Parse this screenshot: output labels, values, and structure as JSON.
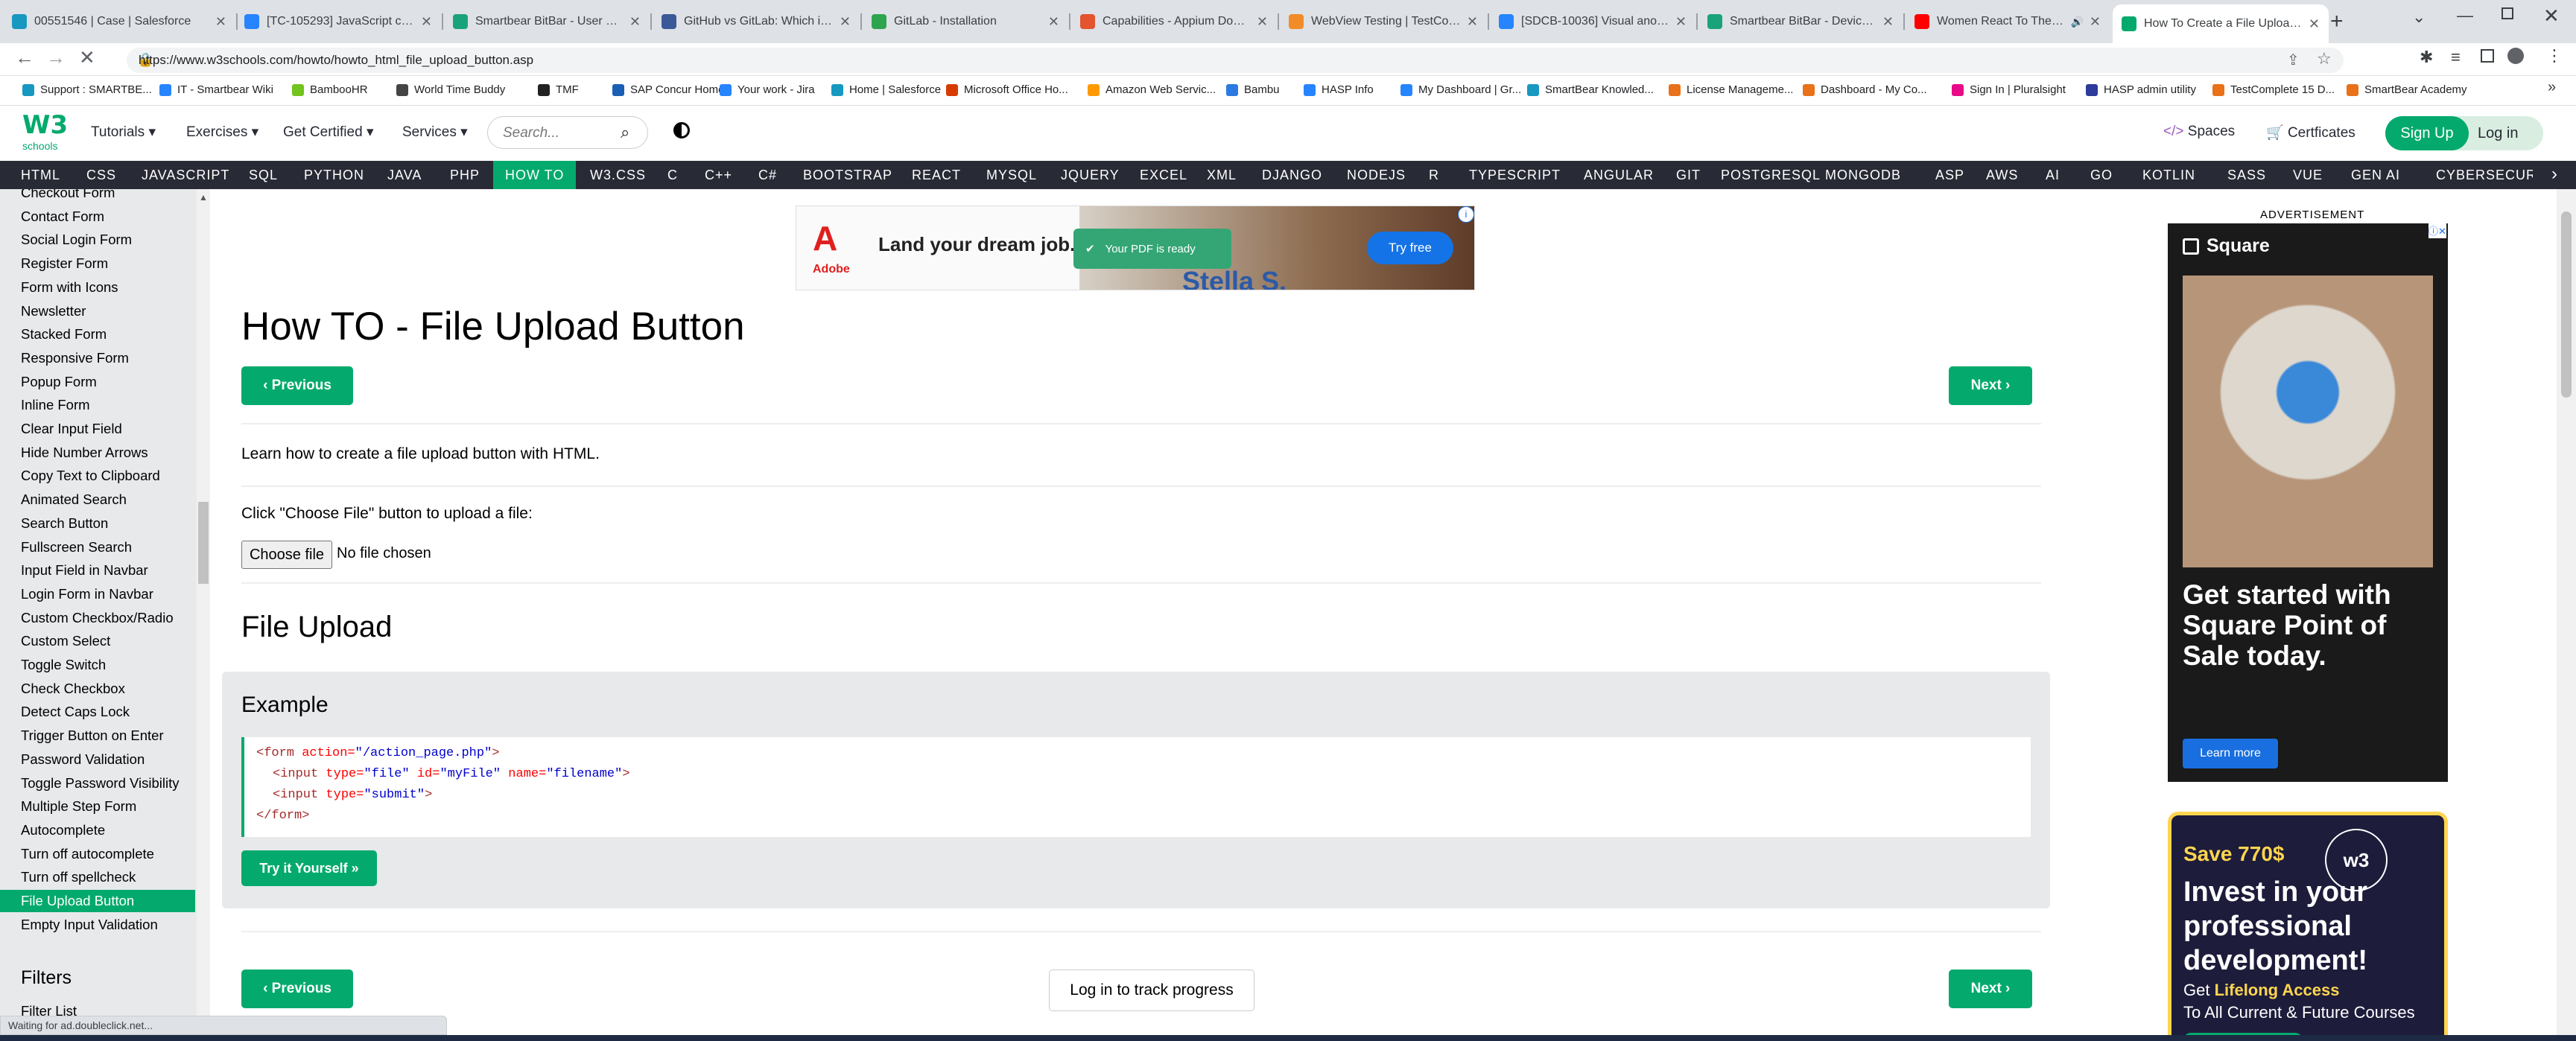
{
  "browser": {
    "tabs": [
      {
        "title": "00551546 | Case | Salesforce",
        "color": "#1798c1"
      },
      {
        "title": "[TC-105293] JavaScript code ...",
        "color": "#2684ff"
      },
      {
        "title": "Smartbear BitBar - User Detail...",
        "color": "#1aa37a"
      },
      {
        "title": "GitHub vs GitLab: Which is Be...",
        "color": "#3b5998"
      },
      {
        "title": "GitLab - Installation",
        "color": "#2ea44f"
      },
      {
        "title": "Capabilities - Appium Docum...",
        "color": "#e3542f"
      },
      {
        "title": "WebView Testing | TestComp...",
        "color": "#f28c28"
      },
      {
        "title": "[SDCB-10036] Visual anomali...",
        "color": "#2684ff"
      },
      {
        "title": "Smartbear BitBar - Device Se...",
        "color": "#1aa37a"
      },
      {
        "title": "Women React To The Re...",
        "color": "#ff0000"
      },
      {
        "title": "How To Create a File Upload ...",
        "color": "#04AA6D"
      }
    ],
    "new_tab": "+",
    "url": "https://www.w3schools.com/howto/howto_html_file_upload_button.asp",
    "bookmarks": [
      {
        "label": "Support : SMARTBE...",
        "color": "#1798c1"
      },
      {
        "label": "IT - Smartbear Wiki",
        "color": "#2684ff"
      },
      {
        "label": "BambooHR",
        "color": "#73c41d"
      },
      {
        "label": "World Time Buddy",
        "color": "#444"
      },
      {
        "label": "TMF",
        "color": "#222"
      },
      {
        "label": "SAP Concur Home",
        "color": "#1a5fb4"
      },
      {
        "label": "Your work - Jira",
        "color": "#2684ff"
      },
      {
        "label": "Home | Salesforce",
        "color": "#1798c1"
      },
      {
        "label": "Microsoft Office Ho...",
        "color": "#d83b01"
      },
      {
        "label": "Amazon Web Servic...",
        "color": "#ff9900"
      },
      {
        "label": "Bambu",
        "color": "#2a7ae2"
      },
      {
        "label": "HASP Info",
        "color": "#2684ff"
      },
      {
        "label": "My Dashboard | Gr...",
        "color": "#2684ff"
      },
      {
        "label": "SmartBear Knowled...",
        "color": "#1798c1"
      },
      {
        "label": "License Manageme...",
        "color": "#e8711a"
      },
      {
        "label": "Dashboard - My Co...",
        "color": "#e8711a"
      },
      {
        "label": "Sign In | Pluralsight",
        "color": "#e80a89"
      },
      {
        "label": "HASP admin utility",
        "color": "#2f3b9a"
      },
      {
        "label": "TestComplete 15 D...",
        "color": "#e8711a"
      },
      {
        "label": "SmartBear Academy",
        "color": "#e8711a"
      }
    ],
    "status_text": "Waiting for ad.doubleclick.net..."
  },
  "header": {
    "logo_main": "W3",
    "logo_sub": "schools",
    "nav": [
      "Tutorials",
      "Exercises",
      "Get Certified",
      "Services"
    ],
    "search_placeholder": "Search...",
    "spaces": "Spaces",
    "certificates": "Certficates",
    "signup": "Sign Up",
    "login": "Log in"
  },
  "topnav": [
    "HTML",
    "CSS",
    "JAVASCRIPT",
    "SQL",
    "PYTHON",
    "JAVA",
    "PHP",
    "HOW TO",
    "W3.CSS",
    "C",
    "C++",
    "C#",
    "BOOTSTRAP",
    "REACT",
    "MYSQL",
    "JQUERY",
    "EXCEL",
    "XML",
    "DJANGO",
    "NODEJS",
    "R",
    "TYPESCRIPT",
    "ANGULAR",
    "GIT",
    "POSTGRESQL",
    "MONGODB",
    "ASP",
    "AWS",
    "AI",
    "GO",
    "KOTLIN",
    "SASS",
    "VUE",
    "GEN AI",
    "CYBERSECURITY"
  ],
  "sidebar": {
    "items": [
      "Checkout Form",
      "Contact Form",
      "Social Login Form",
      "Register Form",
      "Form with Icons",
      "Newsletter",
      "Stacked Form",
      "Responsive Form",
      "Popup Form",
      "Inline Form",
      "Clear Input Field",
      "Hide Number Arrows",
      "Copy Text to Clipboard",
      "Animated Search",
      "Search Button",
      "Fullscreen Search",
      "Input Field in Navbar",
      "Login Form in Navbar",
      "Custom Checkbox/Radio",
      "Custom Select",
      "Toggle Switch",
      "Check Checkbox",
      "Detect Caps Lock",
      "Trigger Button on Enter",
      "Password Validation",
      "Toggle Password Visibility",
      "Multiple Step Form",
      "Autocomplete",
      "Turn off autocomplete",
      "Turn off spellcheck",
      "File Upload Button",
      "Empty Input Validation"
    ],
    "active": "File Upload Button",
    "section": "Filters",
    "next_item": "Filter List"
  },
  "ad_top": {
    "brand": "Adobe",
    "headline": "Land your dream job.",
    "toast": "Your PDF is ready",
    "cta": "Try free",
    "name": "Stella S."
  },
  "main": {
    "title": "How TO - File Upload Button",
    "prev": "Previous",
    "next": "Next",
    "intro": "Learn how to create a file upload button with HTML.",
    "demo_label": "Click \"Choose File\" button to upload a file:",
    "choose_file": "Choose file",
    "no_file": "No file chosen",
    "section_title": "File Upload",
    "example_title": "Example",
    "code": [
      {
        "parts": [
          [
            "t",
            "<form "
          ],
          [
            "a",
            "action="
          ],
          [
            "v",
            "\"/action_page.php\""
          ],
          [
            "t",
            ">"
          ]
        ],
        "indent": 0
      },
      {
        "parts": [
          [
            "t",
            "<input "
          ],
          [
            "a",
            "type="
          ],
          [
            "v",
            "\"file\" "
          ],
          [
            "a",
            "id="
          ],
          [
            "v",
            "\"myFile\" "
          ],
          [
            "a",
            "name="
          ],
          [
            "v",
            "\"filename\""
          ],
          [
            "t",
            ">"
          ]
        ],
        "indent": 1
      },
      {
        "parts": [
          [
            "t",
            "<input "
          ],
          [
            "a",
            "type="
          ],
          [
            "v",
            "\"submit\""
          ],
          [
            "t",
            ">"
          ]
        ],
        "indent": 1
      },
      {
        "parts": [
          [
            "t",
            "</form>"
          ]
        ],
        "indent": 0
      }
    ],
    "try_it": "Try it Yourself »",
    "track": "Log in to track progress"
  },
  "ad_right": {
    "label": "ADVERTISEMENT",
    "brand": "Square",
    "headline": "Get started with Square Point of Sale today.",
    "cta": "Learn more"
  },
  "ad_right2": {
    "save": "Save 770$",
    "headline": "Invest in your professional development!",
    "sub1_pre": "Get ",
    "sub1_bold": "Lifelong Access",
    "sub2": "To All Current & Future Courses"
  },
  "colors": {
    "w3green": "#04AA6D",
    "topnav": "#282A35",
    "sidebar": "#E7E9EB",
    "code_tag": "#a52a2a",
    "code_attr": "#ff0000",
    "code_val": "#0000cd"
  }
}
